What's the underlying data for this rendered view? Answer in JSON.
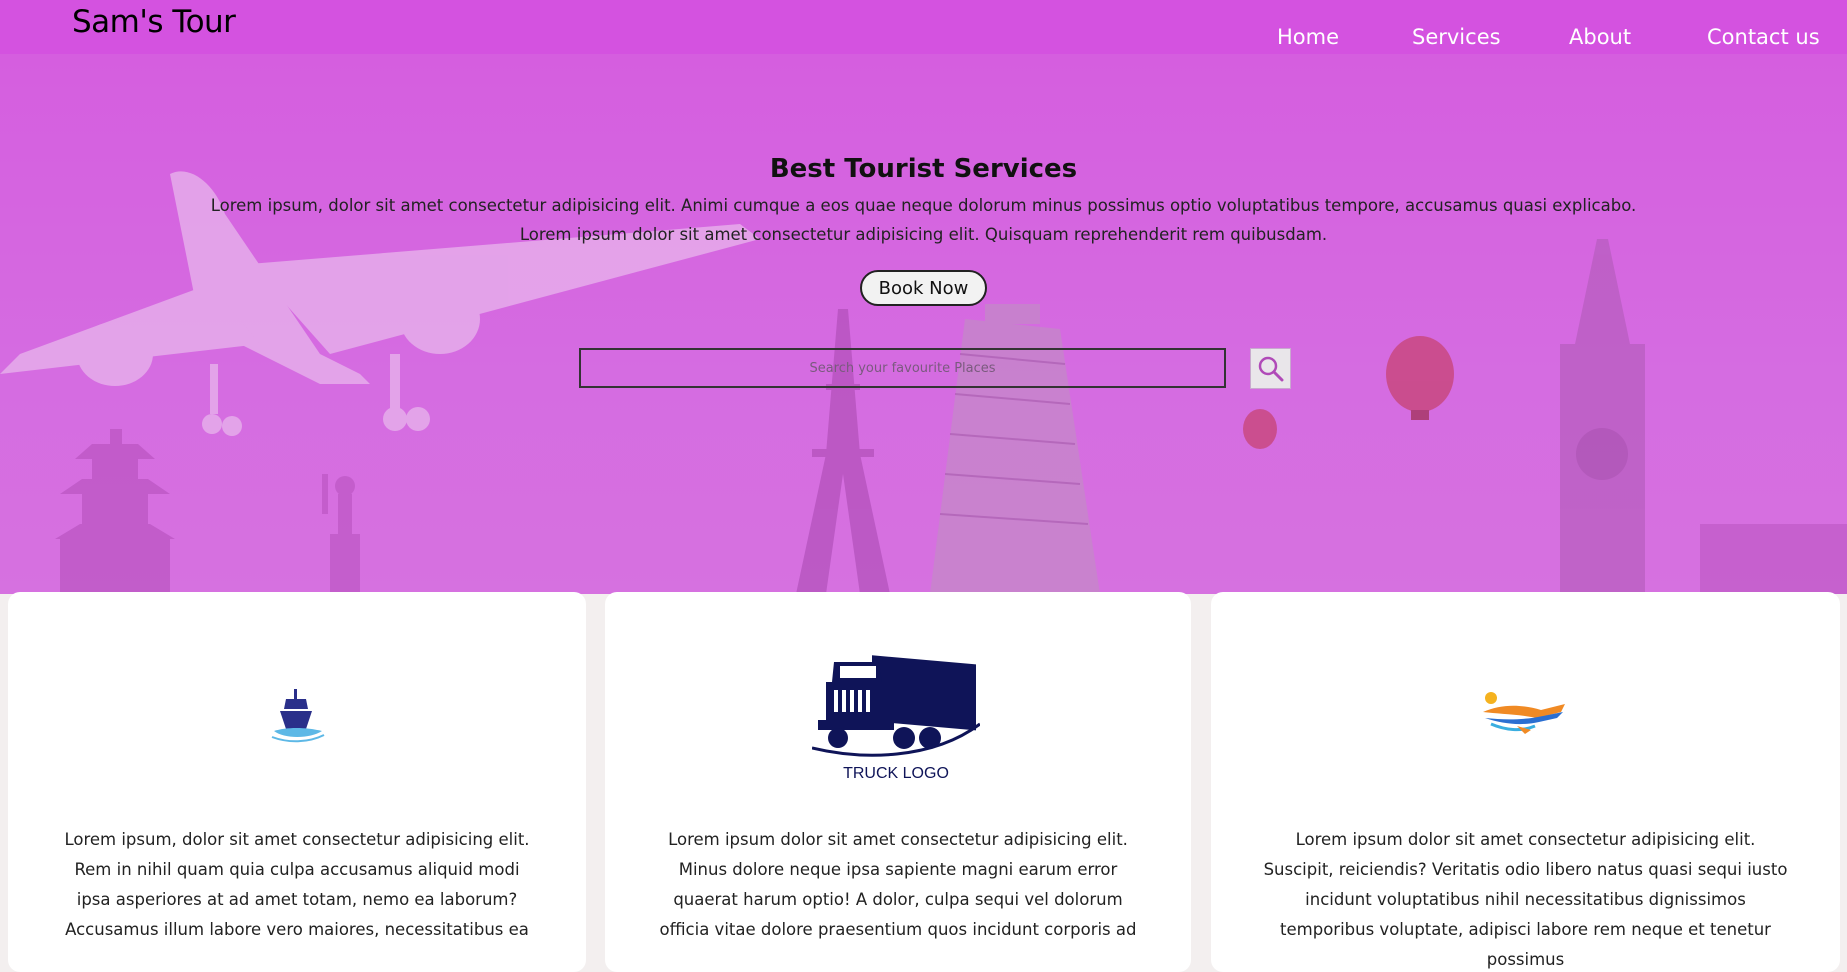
{
  "nav": {
    "brand": "Sam's Tour",
    "links": [
      "Home",
      "Services",
      "About",
      "Contact us"
    ]
  },
  "hero": {
    "title": "Best Tourist Services",
    "line1": "Lorem ipsum, dolor sit amet consectetur adipisicing elit. Animi cumque a eos quae neque dolorum minus possimus optio voluptatibus tempore, accusamus quasi explicabo.",
    "line2": "Lorem ipsum dolor sit amet consectetur adipisicing elit. Quisquam reprehenderit rem quibusdam.",
    "book_label": "Book Now",
    "search_placeholder": "Search your favourite Places"
  },
  "cards": [
    {
      "icon": "ship-icon",
      "text": "Lorem ipsum, dolor sit amet consectetur adipisicing elit. Rem in nihil quam quia culpa accusamus aliquid modi ipsa asperiores at ad amet totam, nemo ea laborum? Accusamus illum labore vero maiores, necessitatibus ea"
    },
    {
      "icon": "truck-logo",
      "logo_text": "TRUCK LOGO",
      "text": "Lorem ipsum dolor sit amet consectetur adipisicing elit. Minus dolore neque ipsa sapiente magni earum error quaerat harum optio! A dolor, culpa sequi vel dolorum officia vitae dolore praesentium quos incidunt corporis ad"
    },
    {
      "icon": "airplane-logo-icon",
      "text": "Lorem ipsum dolor sit amet consectetur adipisicing elit. Suscipit, reiciendis? Veritatis odio libero natus quasi sequi iusto incidunt voluptatibus nihil necessitatibus dignissimos temporibus voluptate, adipisci labore rem neque et tenetur possimus"
    }
  ],
  "colors": {
    "nav_bg": "#d452e0",
    "hero_overlay": "#d55edf",
    "card_bg": "#ffffff",
    "logo_navy": "#0f1458"
  }
}
